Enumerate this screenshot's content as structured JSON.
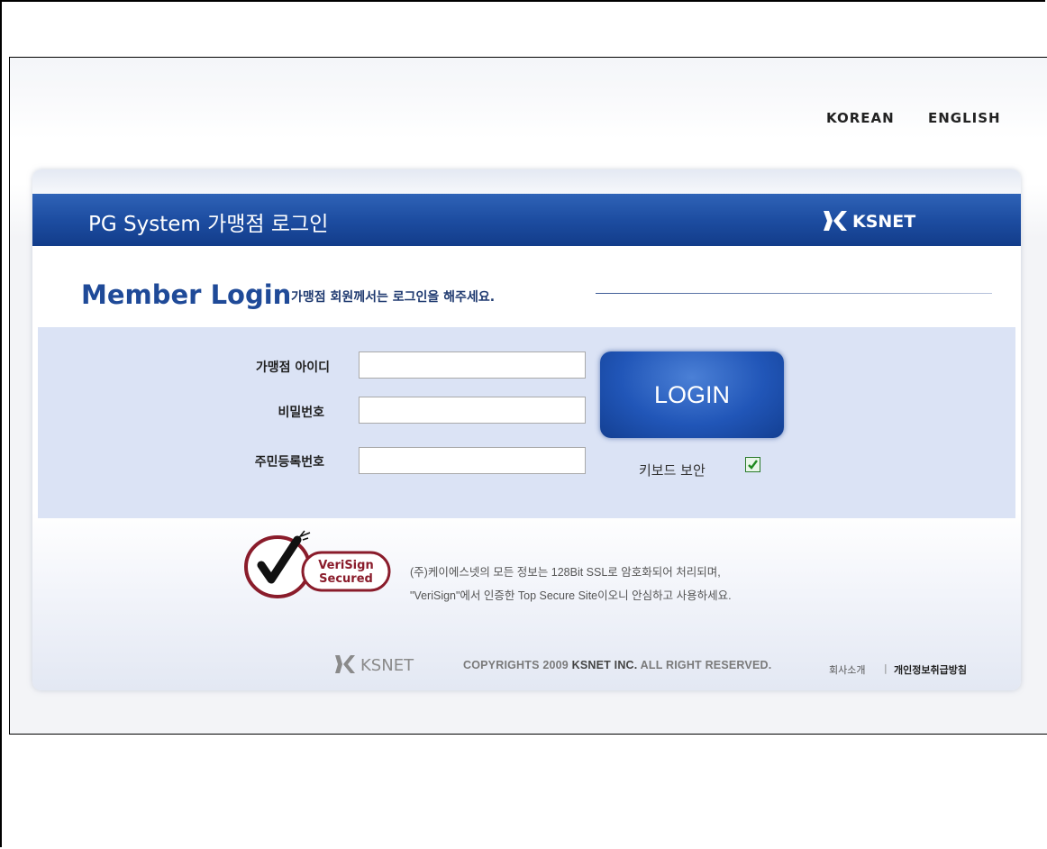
{
  "lang": {
    "korean": "KOREAN",
    "english": "ENGLISH"
  },
  "header": {
    "title": "PG System 가맹점 로그인",
    "logo": "KSNET"
  },
  "member": {
    "title": "Member Login",
    "subtitle": "가맹점 회원께서는 로그인을 해주세요."
  },
  "form": {
    "id_label": "가맹점 아이디",
    "pw_label": "비밀번호",
    "rrn_label": "주민등록번호",
    "id_value": "",
    "pw_value": "",
    "rrn_value": "",
    "login_label": "LOGIN",
    "keyboard_label": "키보드 보안",
    "keyboard_checked": true
  },
  "verisign": {
    "badge_line1": "VeriSign",
    "badge_line2": "Secured",
    "line1": "(주)케이에스넷의 모든 정보는 128Bit SSL로 암호화되어 처리되며,",
    "line2": "\"VeriSign\"에서 인증한 Top Secure Site이오니 안심하고 사용하세요."
  },
  "footer": {
    "logo": "KSNET",
    "copyright_pre": "COPYRIGHTS 2009 ",
    "copyright_company": "KSNET INC.",
    "copyright_post": " ALL RIGHT RESERVED.",
    "link_company": "회사소개",
    "separator": "|",
    "link_privacy": "개인정보취급방침"
  },
  "colors": {
    "brand_blue": "#1d4da1",
    "form_bg": "#dbe3f5",
    "check_green": "#2a9a2a",
    "verisign_red": "#8a1c2b"
  }
}
